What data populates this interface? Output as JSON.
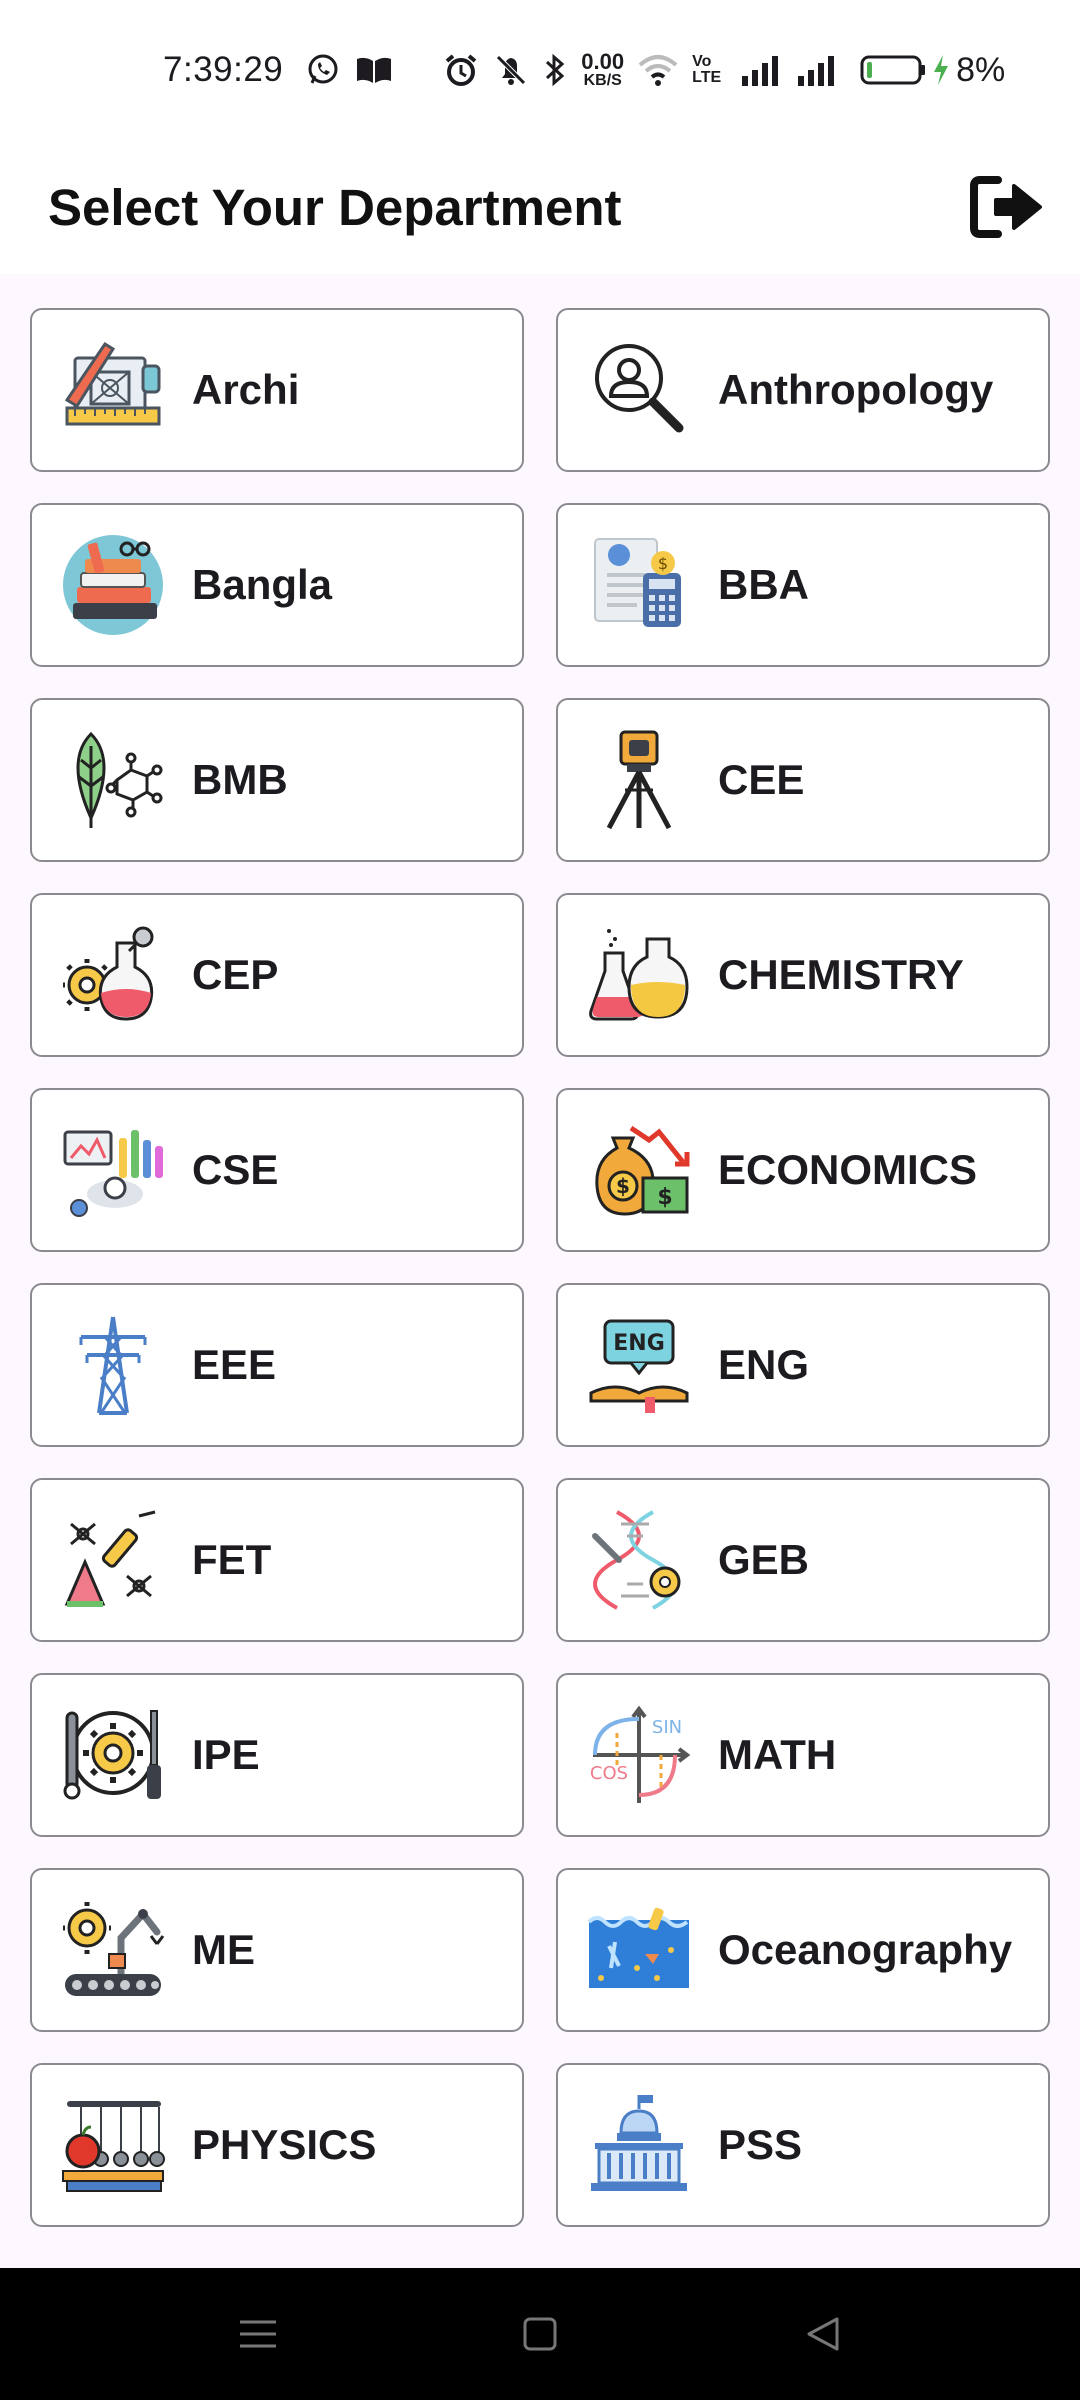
{
  "status_bar": {
    "time": "7:39:29",
    "net_speed_value": "0.00",
    "net_speed_unit": "KB/S",
    "volte": "Vo LTE",
    "battery_pct": "8%"
  },
  "app_bar": {
    "title": "Select Your Department",
    "logout_icon": "logout-icon"
  },
  "departments": [
    {
      "label": "Archi",
      "icon": "architecture-icon"
    },
    {
      "label": "Anthropology",
      "icon": "person-magnifier-icon"
    },
    {
      "label": "Bangla",
      "icon": "books-icon"
    },
    {
      "label": "BBA",
      "icon": "business-calculator-icon"
    },
    {
      "label": "BMB",
      "icon": "leaf-molecule-icon"
    },
    {
      "label": "CEE",
      "icon": "surveying-tripod-icon"
    },
    {
      "label": "CEP",
      "icon": "flask-gear-icon"
    },
    {
      "label": "CHEMISTRY",
      "icon": "chemistry-flasks-icon"
    },
    {
      "label": "CSE",
      "icon": "computer-science-icon"
    },
    {
      "label": "ECONOMICS",
      "icon": "money-bag-chart-icon"
    },
    {
      "label": "EEE",
      "icon": "power-tower-icon"
    },
    {
      "label": "ENG",
      "icon": "eng-book-icon"
    },
    {
      "label": "FET",
      "icon": "food-tech-icon"
    },
    {
      "label": "GEB",
      "icon": "dna-icon"
    },
    {
      "label": "IPE",
      "icon": "industrial-tools-icon"
    },
    {
      "label": "MATH",
      "icon": "trigonometry-icon"
    },
    {
      "label": "ME",
      "icon": "robot-arm-icon"
    },
    {
      "label": "Oceanography",
      "icon": "ocean-icon"
    },
    {
      "label": "PHYSICS",
      "icon": "newtons-cradle-icon"
    },
    {
      "label": "PSS",
      "icon": "capitol-building-icon"
    }
  ],
  "nav_bar": {
    "recent_icon": "menu-icon",
    "home_icon": "home-square-icon",
    "back_icon": "back-triangle-icon"
  }
}
